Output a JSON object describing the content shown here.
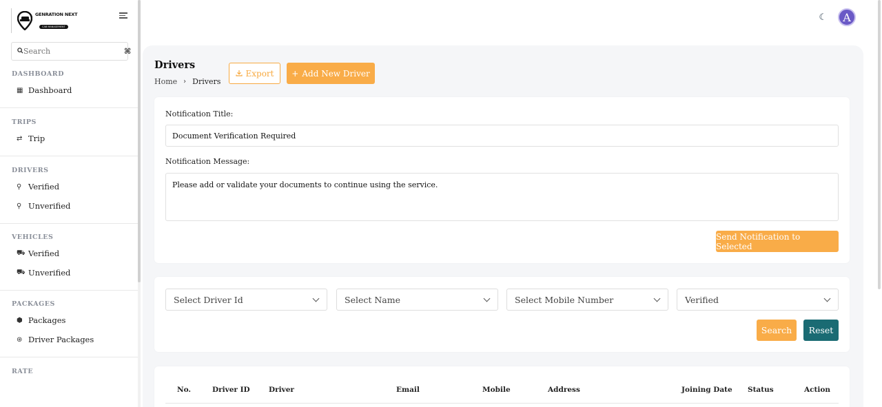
{
  "brand": {
    "line1": "GENRATION NEXT",
    "line2": "CAB MANAGEMENT"
  },
  "search": {
    "placeholder": "Search",
    "shortcut": "⌘"
  },
  "sidebar": {
    "sections": [
      {
        "title": "DASHBOARD",
        "items": [
          {
            "label": "Dashboard",
            "icon": "grid-icon",
            "glyph": "▦"
          }
        ]
      },
      {
        "title": "TRIPS",
        "items": [
          {
            "label": "Trip",
            "icon": "route-icon",
            "glyph": "⇄"
          }
        ]
      },
      {
        "title": "DRIVERS",
        "items": [
          {
            "label": "Verified",
            "icon": "user-check-icon",
            "glyph": "⚲"
          },
          {
            "label": "Unverified",
            "icon": "user-x-icon",
            "glyph": "⚲"
          }
        ]
      },
      {
        "title": "VEHICLES",
        "items": [
          {
            "label": "Verified",
            "icon": "car-icon",
            "glyph": "⛟"
          },
          {
            "label": "Unverified",
            "icon": "car-off-icon",
            "glyph": "⛟"
          }
        ]
      },
      {
        "title": "PACKAGES",
        "items": [
          {
            "label": "Packages",
            "icon": "package-icon",
            "glyph": "⬢"
          },
          {
            "label": "Driver Packages",
            "icon": "package-open-icon",
            "glyph": "⊛"
          }
        ]
      },
      {
        "title": "RATE",
        "items": []
      }
    ]
  },
  "header": {
    "avatar_letter": "A",
    "theme_icon": "moon-icon"
  },
  "page": {
    "title": "Drivers",
    "breadcrumb": [
      "Home",
      "Drivers"
    ],
    "export_label": "Export",
    "add_label": "Add New Driver"
  },
  "notification": {
    "title_label": "Notification Title:",
    "title_value": "Document Verification Required",
    "message_label": "Notification Message:",
    "message_value": "Please add or validate your documents to continue using the service.",
    "send_label": "Send Notification to Selected"
  },
  "filters": {
    "driver_id": "Select Driver Id",
    "name": "Select Name",
    "mobile": "Select Mobile Number",
    "status": "Verified",
    "search_label": "Search",
    "reset_label": "Reset"
  },
  "table": {
    "columns": [
      "No.",
      "Driver ID",
      "Driver",
      "Email",
      "Mobile",
      "Address",
      "Joining Date",
      "Status",
      "Action"
    ]
  },
  "colors": {
    "accent": "#f9ac48",
    "teal": "#1a6b73",
    "avatar": "#6a59c6"
  }
}
